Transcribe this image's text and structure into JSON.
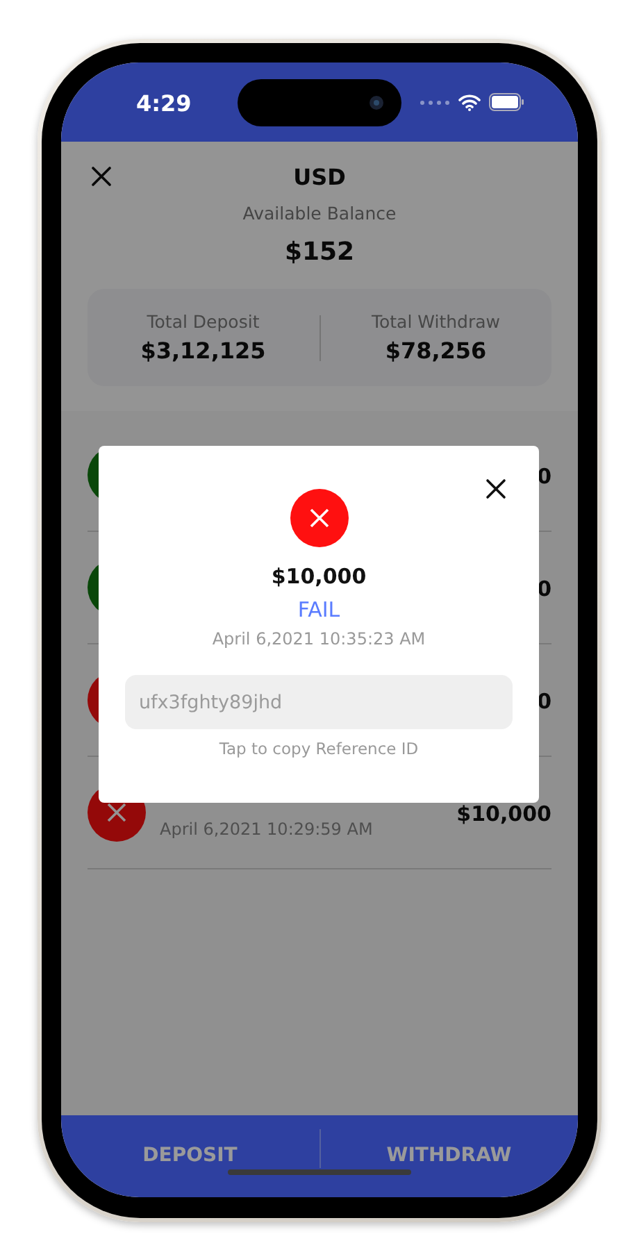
{
  "status_bar": {
    "time": "4:29"
  },
  "header": {
    "title": "USD",
    "balance_label": "Available Balance",
    "balance": "$152"
  },
  "totals": [
    {
      "label": "Total Deposit",
      "value": "$3,12,125"
    },
    {
      "label": "Total Withdraw",
      "value": "$78,256"
    }
  ],
  "transactions": [
    {
      "kind": "success",
      "amount": "0"
    },
    {
      "kind": "success",
      "amount": "0"
    },
    {
      "kind": "fail",
      "amount": "0"
    },
    {
      "kind": "fail",
      "date": "April 6,2021 10:29:59 AM",
      "amount": "$10,000"
    }
  ],
  "modal": {
    "kind": "fail",
    "amount": "$10,000",
    "result": "FAIL",
    "date": "April 6,2021 10:35:23 AM",
    "reference_id": "ufx3fghty89jhd",
    "hint": "Tap to copy Reference ID"
  },
  "bottom_tabs": [
    {
      "label": "DEPOSIT"
    },
    {
      "label": "WITHDRAW"
    }
  ]
}
